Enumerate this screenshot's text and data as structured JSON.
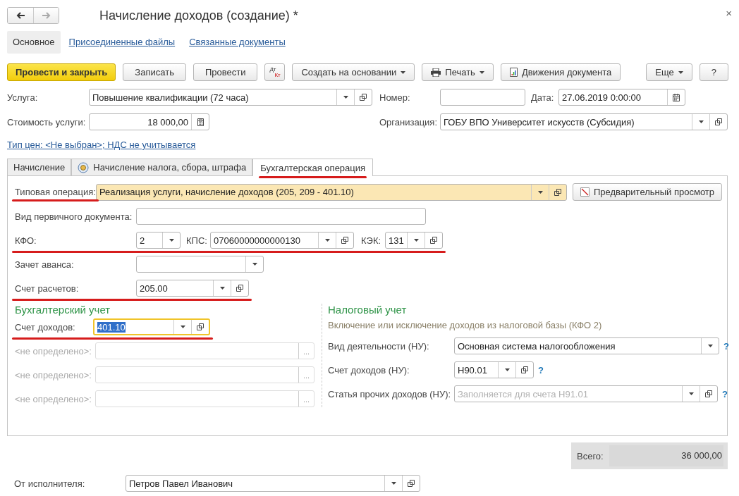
{
  "window": {
    "title": "Начисление доходов (создание) *",
    "close": "×"
  },
  "nav_buttons": [
    {
      "kind": "back",
      "disabled": false
    },
    {
      "kind": "forward",
      "disabled": true
    }
  ],
  "sections": [
    {
      "label": "Основное",
      "selected": true
    },
    {
      "label": "Присоединенные файлы",
      "selected": false
    },
    {
      "label": "Связанные документы",
      "selected": false
    }
  ],
  "toolbar_left": [
    {
      "kind": "primary",
      "label": "Провести и закрыть"
    },
    {
      "kind": "plain",
      "label": "Записать"
    },
    {
      "kind": "plain",
      "label": "Провести"
    },
    {
      "kind": "dtkt",
      "label": "Дт",
      "sub": "Кт"
    },
    {
      "kind": "menu",
      "label": "Создать на основании"
    },
    {
      "kind": "print",
      "label": "Печать"
    },
    {
      "kind": "report",
      "label": "Движения документа"
    }
  ],
  "toolbar_right": [
    {
      "kind": "menu",
      "label": "Еще"
    },
    {
      "kind": "plain",
      "label": "?"
    }
  ],
  "service": {
    "label": "Услуга:",
    "value": "Повышение квалификации (72 часа)"
  },
  "number": {
    "label": "Номер:"
  },
  "date": {
    "label": "Дата:",
    "value": "27.06.2019  0:00:00"
  },
  "cost": {
    "label": "Стоимость услуги:",
    "value": "18 000,00"
  },
  "organization": {
    "label": "Организация:",
    "value": "ГОБУ ВПО Университет искусств (Субсидия)"
  },
  "price_link": "Тип цен: <Не выбран>; НДС не учитывается",
  "tabs": [
    {
      "label": "Начисление",
      "selected": false,
      "kind": "plain",
      "underlined": false
    },
    {
      "label": "Начисление налога, сбора, штрафа",
      "selected": false,
      "kind": "emblem",
      "underlined": false
    },
    {
      "label": "Бухгалтерская операция",
      "selected": true,
      "kind": "plain",
      "underlined": true
    }
  ],
  "operation": {
    "label": "Типовая операция:",
    "value": "Реализация услуги, начисление доходов (205, 209 - 401.10)",
    "underlined": true
  },
  "preview_button": "Предварительный просмотр",
  "primary_doc": {
    "label": "Вид первичного документа:"
  },
  "codes": {
    "underlined": true,
    "kfo": {
      "label": "КФО:",
      "value": "2"
    },
    "kps": {
      "label": "КПС:",
      "value": "07060000000000130"
    },
    "kek": {
      "label": "КЭК:",
      "value": "131"
    }
  },
  "advance": {
    "label": "Зачет аванса:"
  },
  "settlement": {
    "label": "Счет расчетов:",
    "value": "205.00",
    "underlined": true
  },
  "accounting": {
    "title": "Бухгалтерский учет",
    "income": {
      "label": "Счет доходов:",
      "value": "401.10",
      "focused": true,
      "underlined": true
    },
    "extra_rows": [
      {
        "label": "<не определено>:",
        "disabled": true,
        "button": "..."
      },
      {
        "label": "<не определено>:",
        "disabled": true,
        "button": "..."
      },
      {
        "label": "<не определено>:",
        "disabled": true,
        "button": "..."
      }
    ]
  },
  "tax": {
    "title": "Налоговый учет",
    "note": "Включение или исключение доходов из налоговой базы (КФО 2)",
    "fields": [
      {
        "kind": "wide",
        "label": "Вид деятельности (НУ):",
        "value": "Основная система налогообложения",
        "help": "?"
      },
      {
        "kind": "short",
        "label": "Счет доходов (НУ):",
        "value": "Н90.01",
        "help": "?"
      },
      {
        "kind": "wide-open",
        "label": "Статья прочих доходов (НУ):",
        "placeholder": "Заполняется для счета Н91.01",
        "help": "?"
      }
    ]
  },
  "total": {
    "label": "Всего:",
    "value": "36 000,00"
  },
  "performer": {
    "label": "От исполнителя:",
    "value": "Петров Павел Иванович"
  }
}
